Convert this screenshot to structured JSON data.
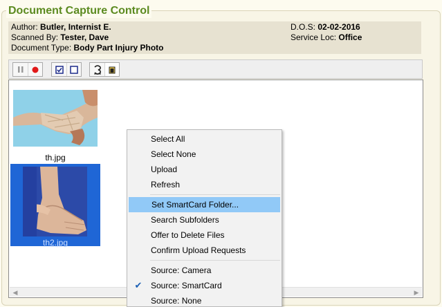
{
  "panel": {
    "title": "Document Capture Control"
  },
  "info": {
    "author_label": "Author: ",
    "author_value": "Butler, Internist E.",
    "scanned_label": "Scanned By: ",
    "scanned_value": "Tester, Dave",
    "doctype_label": "Document Type: ",
    "doctype_value": "Body Part Injury Photo",
    "dos_label": "D.O.S: ",
    "dos_value": "02-02-2016",
    "loc_label": "Service Loc: ",
    "loc_value": "Office"
  },
  "toolbar": {
    "buttons": [
      "pause-icon",
      "record-icon",
      "check-all-icon",
      "uncheck-all-icon",
      "rotate-icon",
      "card-icon"
    ]
  },
  "thumbnails": [
    {
      "label": "th.jpg",
      "selected": false
    },
    {
      "label": "th2.jpg",
      "selected": true
    }
  ],
  "context_menu": {
    "items": [
      {
        "label": "Select All"
      },
      {
        "label": "Select None"
      },
      {
        "label": "Upload"
      },
      {
        "label": "Refresh"
      },
      {
        "label": "Set SmartCard Folder...",
        "highlighted": true
      },
      {
        "label": "Search Subfolders"
      },
      {
        "label": "Offer to Delete Files"
      },
      {
        "label": "Confirm Upload Requests"
      },
      {
        "label": "Source: Camera"
      },
      {
        "label": "Source: SmartCard",
        "checked": true
      },
      {
        "label": "Source: None"
      }
    ]
  },
  "colors": {
    "title_green": "#5b8a1f",
    "selection_blue": "#1f66d6",
    "menu_highlight": "#91c9f7"
  }
}
